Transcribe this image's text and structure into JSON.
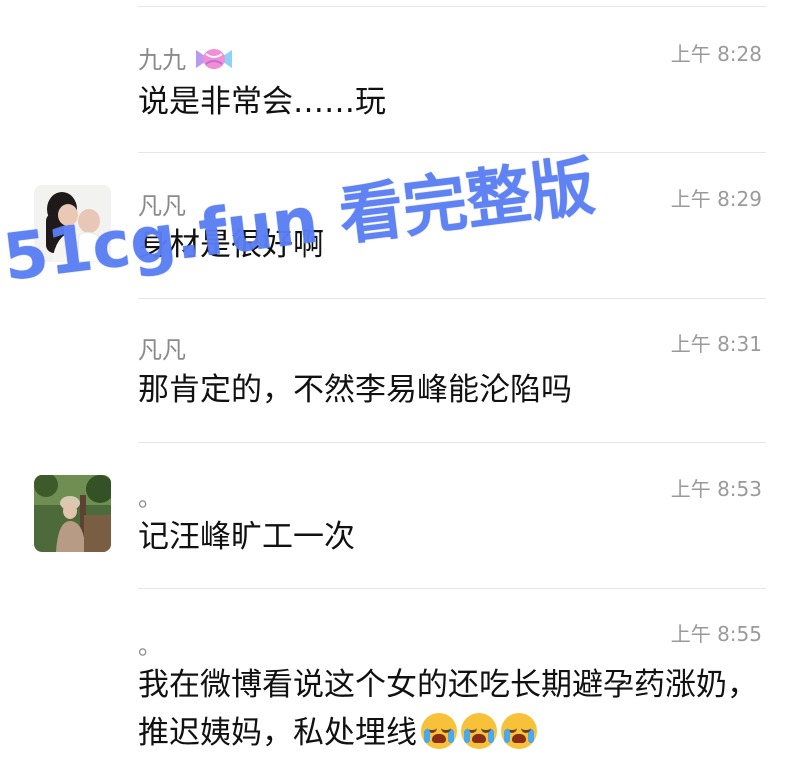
{
  "messages": [
    {
      "sender": "九九",
      "sender_decoration": "candy-icon",
      "time": "上午 8:28",
      "text": "说是非常会……玩",
      "has_avatar": false
    },
    {
      "sender": "凡凡",
      "time": "上午 8:29",
      "text": "身材是很好啊",
      "has_avatar": true,
      "avatar": "woman-holding-baby-avatar"
    },
    {
      "sender": "凡凡",
      "time": "上午 8:31",
      "text": "那肯定的，不然李易峰能沦陷吗",
      "has_avatar": false
    },
    {
      "sender": "。",
      "time": "上午 8:53",
      "text": "记汪峰旷工一次",
      "has_avatar": true,
      "avatar": "person-outdoor-avatar"
    },
    {
      "sender": "。",
      "time": "上午 8:55",
      "text": "我在微博看说这个女的还吃长期避孕药涨奶，推迟姨妈，私处埋线",
      "emojis": [
        "crying-face-icon",
        "crying-face-icon",
        "crying-face-icon"
      ],
      "has_avatar": false
    }
  ],
  "watermark": {
    "text": "51cg.fun 看完整版",
    "color": "#5a7ef4"
  },
  "colors": {
    "sender": "#8a8a8a",
    "time": "#9a9a9a",
    "text": "#111111",
    "divider": "#e6e6e6"
  }
}
